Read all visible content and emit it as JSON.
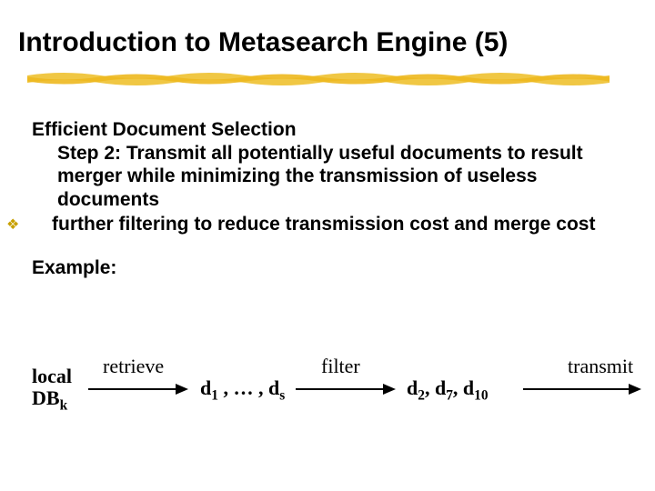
{
  "title": "Introduction to Metasearch Engine (5)",
  "section_heading": "Efficient Document Selection",
  "step_text": "Step 2: Transmit all potentially useful documents to result merger while minimizing the transmission of useless documents",
  "bullet_text": "further filtering to reduce transmission cost and merge cost",
  "example_label": "Example:",
  "flow": {
    "local_label_line1": "local",
    "local_label_line2_prefix": "DB",
    "local_label_line2_sub": "k",
    "edge1_label": "retrieve",
    "node2_prefix": "d",
    "node2_sub1": "1",
    "node2_mid": " , … , d",
    "node2_sub2": "s",
    "edge2_label": "filter",
    "node3_p1": "d",
    "node3_s1": "2",
    "node3_p2": ", d",
    "node3_s2": "7",
    "node3_p3": ", d",
    "node3_s3": "10",
    "edge3_label": "transmit"
  }
}
